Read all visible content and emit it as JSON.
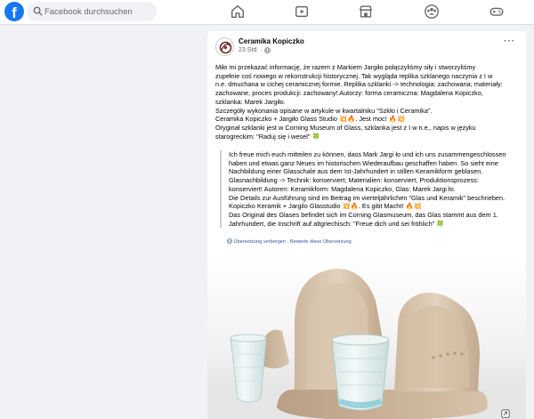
{
  "header": {
    "logo": "f",
    "search_placeholder": "Facebook durchsuchen",
    "nav_icons": [
      "home-icon",
      "video-icon",
      "marketplace-icon",
      "groups-icon",
      "gaming-icon"
    ]
  },
  "post": {
    "author": "Ceramika Kopiczko",
    "time": "23 Std.",
    "visibility_icon": "globe-icon",
    "more_label": "···",
    "text": [
      "Miło mi przekazać informację, że razem z Markiem Jargiło połączyliśmy siły i stworzyliśmy",
      "zupełnie coś nowego w rekonstrukcji historycznej. Tak wygląda replika szklanego naczynia z I w",
      "n.e. dmuchana w cichej ceramicznej formie. Replika szklanki -> technologia: zachowana; materiały:",
      "zachowane, proces produkcji: zachowany! Autorzy: forma ceramiczna: Magdalena Kopiczko,",
      "szklanka: Marek Jargiło.",
      "Szczegóły wykonania opisane w artykule w kwartalniku \"Szkło i Ceramika\".",
      "Ceramika Kopiczko + Jargiło Glass Studio 💥🔥. Jest moc! 🔥💥",
      "Oryginał szklanki jest w Corning Museum of Glass, szklanka jest z I w n.e., napis w języku",
      "starogreckim: \"Raduj się i wesel\" 🍀"
    ],
    "translation": [
      "Ich freue mich euch mitteilen zu können, dass Mark Jargi ło und ich uns zusammengeschlossen",
      "haben und etwas ganz Neues im historischen Wiederaufbau geschaffen haben. So sieht eine",
      "Nachbildung einer Glasschale aus dem Ist-Jahrhundert in stillen Keramikform geblasen.",
      "Glasnachbildung -> Technik: konserviert; Materialien: konserviert, Produktionsprozess:",
      "konserviert! Autoren: Keramikform: Magdalena Kopiczko, Glas: Marek Jargi ło.",
      "Die Details zur Ausführung sind im Beitrag im vierteljährlichen \"Glas und Keramik\" beschrieben.",
      "Kopiczko Keramik + Jargilo Glasstudio 💥🔥. Es gibt Macht! 🔥💥",
      "Das Original des Glases befindet sich im Corning Glasmuseum, das Glas stammt aus dem 1.",
      "Jahrhundert, die Inschrift auf altgriechisch: \"Freue dich und sei fröhlich\" 🍀"
    ],
    "translation_hide": "Übersetzung verbergen",
    "translation_separator": " · ",
    "translation_rate": "Bewerte diese Übersetzung"
  }
}
